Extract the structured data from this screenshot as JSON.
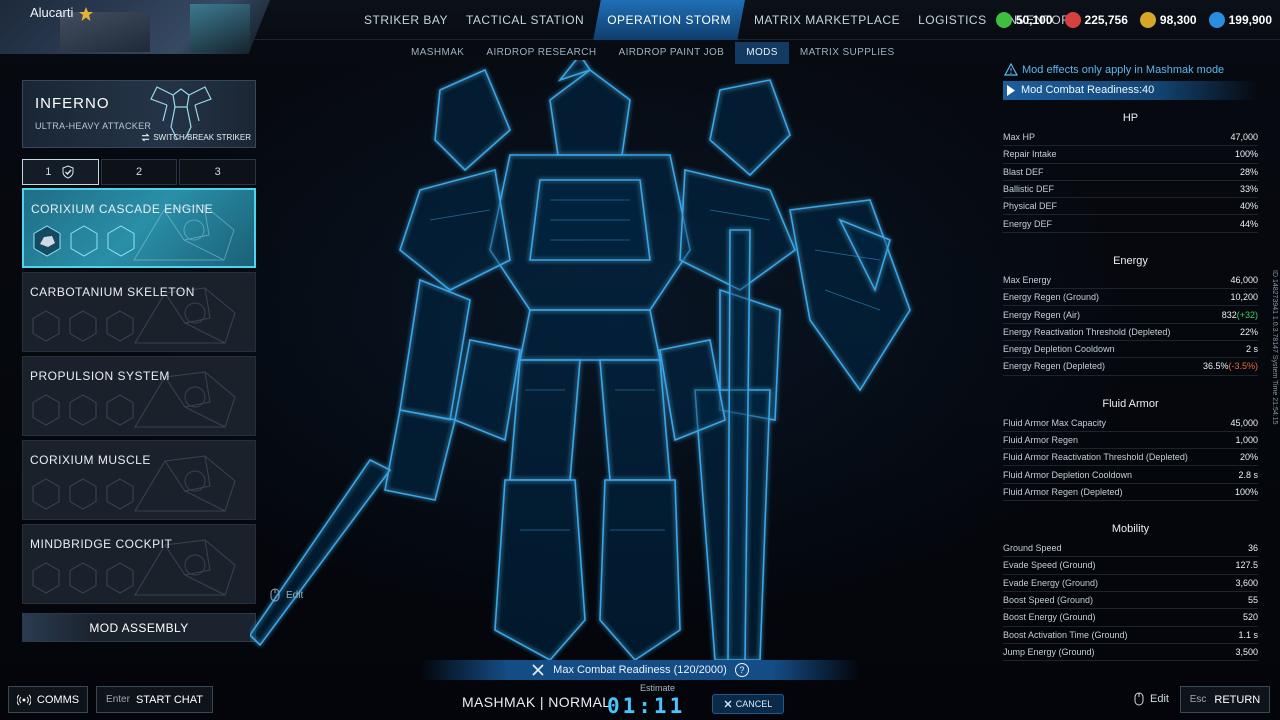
{
  "player": {
    "name": "Alucarti"
  },
  "main_nav": [
    {
      "label": "STRIKER BAY",
      "active": false
    },
    {
      "label": "TACTICAL STATION",
      "active": false
    },
    {
      "label": "OPERATION STORM",
      "active": true
    },
    {
      "label": "MATRIX MARKETPLACE",
      "active": false
    },
    {
      "label": "LOGISTICS",
      "active": false
    },
    {
      "label": "INVENTORY",
      "active": false
    }
  ],
  "currencies": [
    {
      "icon": "green-crystal-icon",
      "value": "50,100",
      "color": "#3fbf3f"
    },
    {
      "icon": "red-coin-icon",
      "value": "225,756",
      "color": "#d84040"
    },
    {
      "icon": "gold-hex-icon",
      "value": "98,300",
      "color": "#d6a52a"
    },
    {
      "icon": "blue-coin-icon",
      "value": "199,900",
      "color": "#2a8ee0"
    }
  ],
  "sub_nav": [
    {
      "label": "MASHMAK",
      "active": false
    },
    {
      "label": "AIRDROP RESEARCH",
      "active": false
    },
    {
      "label": "AIRDROP PAINT JOB",
      "active": false
    },
    {
      "label": "MODS",
      "active": true
    },
    {
      "label": "MATRIX SUPPLIES",
      "active": false
    }
  ],
  "striker": {
    "name": "INFERNO",
    "class": "ULTRA-HEAVY ATTACKER",
    "switch_label": "SWITCH BREAK STRIKER"
  },
  "presets": [
    "1",
    "2",
    "3"
  ],
  "mod_slots": [
    {
      "label": "CORIXIUM CASCADE ENGINE",
      "active": true
    },
    {
      "label": "CARBOTANIUM SKELETON",
      "active": false
    },
    {
      "label": "PROPULSION SYSTEM",
      "active": false
    },
    {
      "label": "CORIXIUM MUSCLE",
      "active": false
    },
    {
      "label": "MINDBRIDGE COCKPIT",
      "active": false
    }
  ],
  "mod_assembly_label": "MOD ASSEMBLY",
  "edit_label": "Edit",
  "readiness_bar": "Max Combat Readiness  (120/2000)",
  "help_glyph": "?",
  "mode_text": "MASHMAK | NORMAL",
  "estimate_label": "Estimate",
  "timer": "01:11",
  "cancel_label": "CANCEL",
  "comms_label": "COMMS",
  "chat": {
    "key": "Enter",
    "label": "START CHAT"
  },
  "return": {
    "key": "Esc",
    "label": "RETURN"
  },
  "notice": "Mod effects only apply in Mashmak mode",
  "readiness_tag": "Mod Combat Readiness:40",
  "stats": [
    {
      "title": "HP",
      "rows": [
        {
          "label": "Max HP",
          "value": "47,000"
        },
        {
          "label": "Repair Intake",
          "value": "100%"
        },
        {
          "label": "Blast DEF",
          "value": "28%"
        },
        {
          "label": "Ballistic DEF",
          "value": "33%"
        },
        {
          "label": "Physical DEF",
          "value": "40%"
        },
        {
          "label": "Energy DEF",
          "value": "44%"
        }
      ]
    },
    {
      "title": "Energy",
      "rows": [
        {
          "label": "Max Energy",
          "value": "46,000"
        },
        {
          "label": "Energy Regen (Ground)",
          "value": "10,200"
        },
        {
          "label": "Energy Regen (Air)",
          "value": "832",
          "delta": "(+32)",
          "delta_type": "up"
        },
        {
          "label": "Energy Reactivation Threshold (Depleted)",
          "value": "22%"
        },
        {
          "label": "Energy Depletion Cooldown",
          "value": "2 s"
        },
        {
          "label": "Energy Regen (Depleted)",
          "value": "36.5%",
          "delta": "(-3.5%)",
          "delta_type": "down"
        }
      ]
    },
    {
      "title": "Fluid Armor",
      "rows": [
        {
          "label": "Fluid Armor Max Capacity",
          "value": "45,000"
        },
        {
          "label": "Fluid Armor Regen",
          "value": "1,000"
        },
        {
          "label": "Fluid Armor Reactivation Threshold (Depleted)",
          "value": "20%"
        },
        {
          "label": "Fluid Armor Depletion Cooldown",
          "value": "2.8 s"
        },
        {
          "label": "Fluid Armor Regen (Depleted)",
          "value": "100%"
        }
      ]
    },
    {
      "title": "Mobility",
      "rows": [
        {
          "label": "Ground Speed",
          "value": "36"
        },
        {
          "label": "Evade Speed (Ground)",
          "value": "127.5"
        },
        {
          "label": "Evade Energy (Ground)",
          "value": "3,600"
        },
        {
          "label": "Boost Speed (Ground)",
          "value": "55"
        },
        {
          "label": "Boost Energy (Ground)",
          "value": "520"
        },
        {
          "label": "Boost Activation Time (Ground)",
          "value": "1.1 s"
        },
        {
          "label": "Jump Energy (Ground)",
          "value": "3,500"
        }
      ]
    }
  ],
  "vertical_info": "ID 14827394​1   1.0.3.78147   System Time 21:54:15"
}
